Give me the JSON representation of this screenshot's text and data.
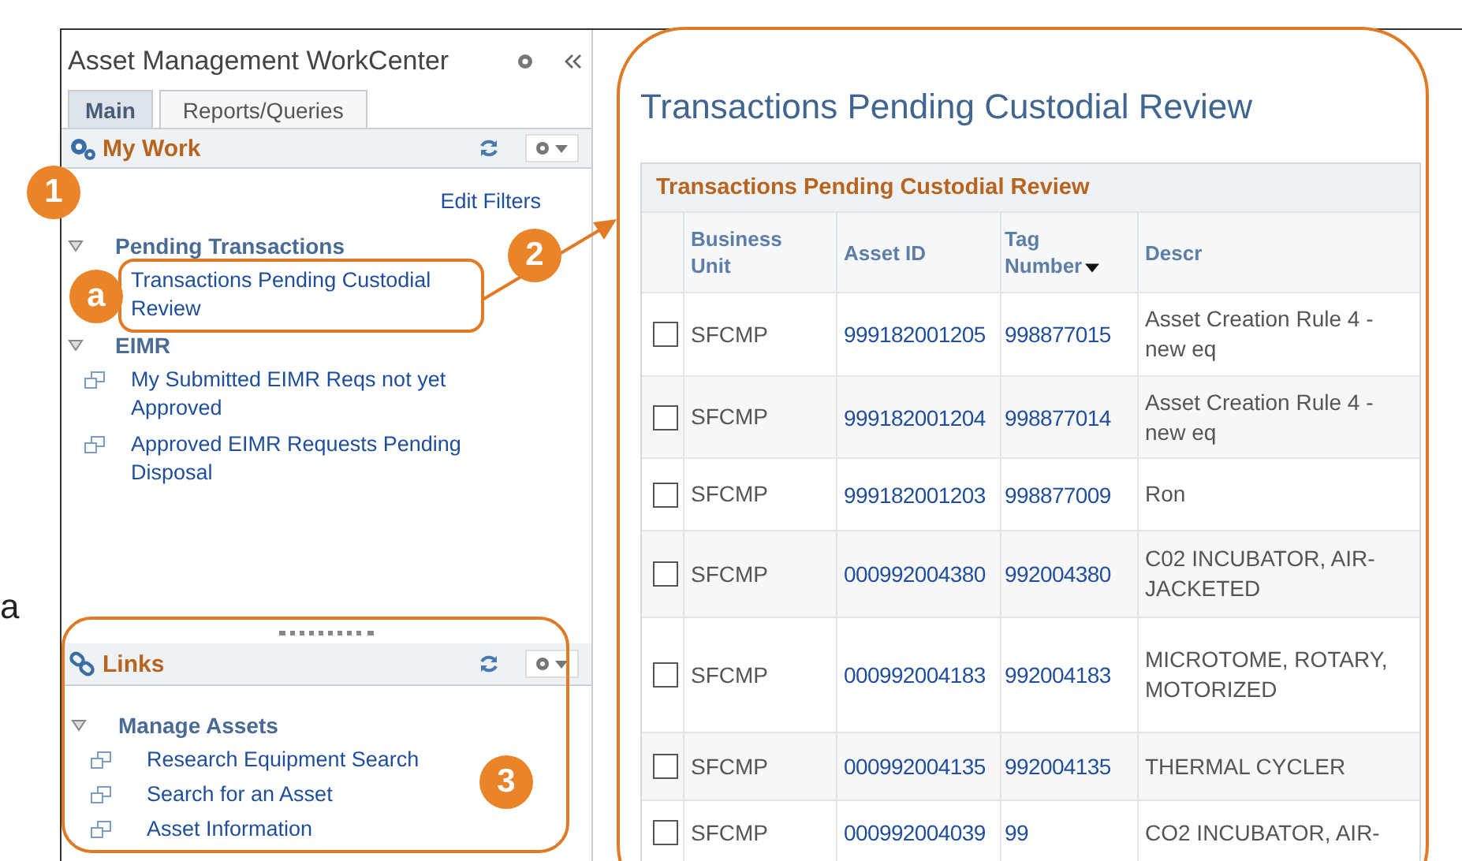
{
  "stray_text": "a",
  "sidebar": {
    "title": "Asset Management WorkCenter",
    "tabs": [
      {
        "label": "Main",
        "selected": true
      },
      {
        "label": "Reports/Queries",
        "selected": false
      }
    ],
    "my_work": {
      "title": "My Work",
      "edit_filters": "Edit Filters",
      "groups": [
        {
          "label": "Pending Transactions",
          "expanded": true,
          "children": [
            {
              "label": "Transactions Pending Custodial Review",
              "kind": "plain"
            }
          ]
        },
        {
          "label": "EIMR",
          "expanded": true,
          "children": [
            {
              "label": "My Submitted EIMR Reqs not yet Approved",
              "kind": "window"
            },
            {
              "label": "Approved EIMR Requests Pending Disposal",
              "kind": "window"
            }
          ]
        }
      ]
    },
    "links": {
      "title": "Links",
      "groups": [
        {
          "label": "Manage Assets",
          "expanded": true,
          "children": [
            {
              "label": "Research Equipment Search",
              "kind": "window"
            },
            {
              "label": "Search for an Asset",
              "kind": "window"
            },
            {
              "label": "Asset Information",
              "kind": "window"
            }
          ]
        }
      ]
    }
  },
  "main": {
    "title": "Transactions Pending Custodial Review",
    "grid": {
      "title": "Transactions Pending Custodial Review",
      "columns": [
        {
          "label": "Business Unit",
          "sorted": false
        },
        {
          "label": "Asset ID",
          "sorted": false
        },
        {
          "label": "Tag Number",
          "sorted": true
        },
        {
          "label": "Descr",
          "sorted": false
        }
      ],
      "rows": [
        {
          "checked": false,
          "business_unit": "SFCMP",
          "asset_id": "999182001205",
          "tag_number": "998877015",
          "descr": "Asset Creation Rule 4 - new eq"
        },
        {
          "checked": false,
          "business_unit": "SFCMP",
          "asset_id": "999182001204",
          "tag_number": "998877014",
          "descr": "Asset Creation Rule 4 - new eq"
        },
        {
          "checked": false,
          "business_unit": "SFCMP",
          "asset_id": "999182001203",
          "tag_number": "998877009",
          "descr": "Ron"
        },
        {
          "checked": false,
          "business_unit": "SFCMP",
          "asset_id": "000992004380",
          "tag_number": "992004380",
          "descr": "C02 INCUBATOR, AIR-JACKETED"
        },
        {
          "checked": false,
          "business_unit": "SFCMP",
          "asset_id": "000992004183",
          "tag_number": "992004183",
          "descr": "MICROTOME, ROTARY, MOTORIZED"
        },
        {
          "checked": false,
          "business_unit": "SFCMP",
          "asset_id": "000992004135",
          "tag_number": "992004135",
          "descr": "THERMAL CYCLER"
        },
        {
          "checked": false,
          "business_unit": "SFCMP",
          "asset_id": "000992004039",
          "tag_number": "99",
          "descr": "CO2 INCUBATOR, AIR-"
        }
      ]
    }
  },
  "callouts": [
    {
      "label": "1"
    },
    {
      "label": "a"
    },
    {
      "label": "2"
    },
    {
      "label": "3"
    }
  ]
}
